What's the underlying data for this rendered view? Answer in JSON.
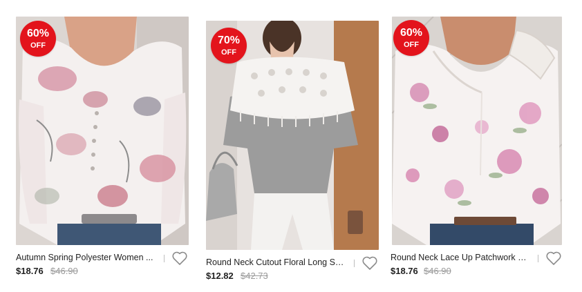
{
  "products": [
    {
      "title": "Autumn Spring Polyester Women ...",
      "price": "$18.76",
      "old_price": "$46.90",
      "discount": "60%",
      "discount_suffix": "OFF",
      "badge_color": "#e3141c"
    },
    {
      "title": "Round Neck Cutout Floral Long Sl...",
      "price": "$12.82",
      "old_price": "$42.73",
      "discount": "70%",
      "discount_suffix": "OFF",
      "badge_color": "#e3141c"
    },
    {
      "title": "Round Neck Lace Up Patchwork L...",
      "price": "$18.76",
      "old_price": "$46.90",
      "discount": "60%",
      "discount_suffix": "OFF",
      "badge_color": "#e3141c"
    }
  ],
  "icons": {
    "wishlist": "heart-outline-icon"
  }
}
